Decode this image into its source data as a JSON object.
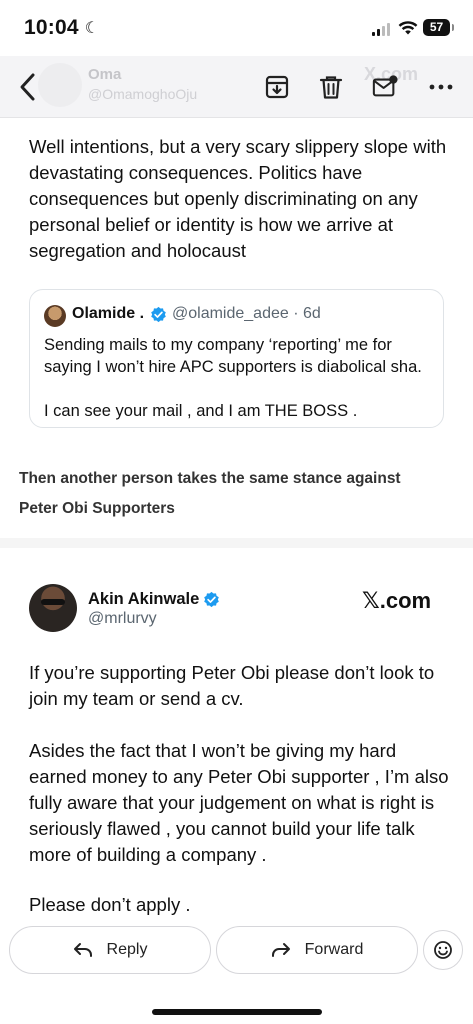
{
  "status_bar": {
    "time": "10:04",
    "battery": "57"
  },
  "header": {
    "sender_name": "Oma",
    "sender_handle": "@OmamoghoOju",
    "ghost_domain": "X.com",
    "icons": [
      "back-chevron-icon",
      "archive-icon",
      "trash-icon",
      "mail-unread-icon",
      "more-icon"
    ]
  },
  "email_body": {
    "paragraph1": "Well intentions, but a very scary slippery slope with devastating consequences. Politics have consequences but openly discriminating on any personal belief or identity is how we arrive at segregation and holocaust",
    "quote": {
      "name": "Olamide .",
      "handle": "@olamide_adee · 6d",
      "text": "Sending mails to my company ‘reporting’ me for saying I won’t hire APC supporters is diabolical sha.",
      "text2": "I can see your mail , and I am THE BOSS ."
    },
    "mid_text_line1": "Then another person takes the same stance against",
    "mid_text_line2": "Peter Obi Supporters",
    "tweet": {
      "name": "Akin Akinwale",
      "handle": "@mrlurvy",
      "domain": "𝕏.com",
      "paragraph1": "If you’re supporting Peter Obi please don’t look to join my team or send a cv.",
      "paragraph2": "Asides the fact that I won’t be giving my hard earned money to any Peter Obi supporter , I’m also fully aware that your judgement on what is right is seriously flawed , you cannot build your life talk more of building a company .",
      "paragraph3": "Please don’t apply ."
    }
  },
  "actions": {
    "reply_label": "Reply",
    "forward_label": "Forward"
  },
  "colors": {
    "verified_blue": "#1d9bf0",
    "handle_gray": "#5b6670",
    "header_bg": "#f4f4f6"
  }
}
